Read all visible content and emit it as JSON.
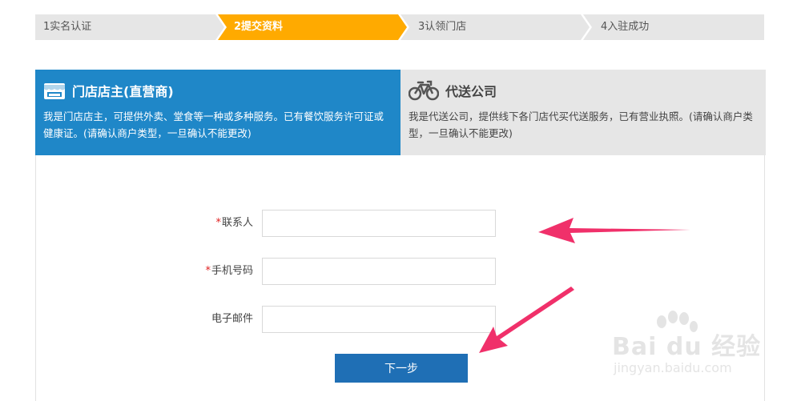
{
  "steps": [
    {
      "label": "1实名认证",
      "state": "done"
    },
    {
      "label": "2提交资料",
      "state": "active"
    },
    {
      "label": "3认领门店",
      "state": "pending"
    },
    {
      "label": "4入驻成功",
      "state": "pending"
    }
  ],
  "colors": {
    "step_active": "#ffaa00",
    "step_inactive": "#e6e6e6",
    "tab_active": "#1f87c8",
    "tab_inactive": "#e6e6e6",
    "button": "#1f6fb5",
    "required": "#e02020",
    "annotation_arrow": "#f0306a"
  },
  "merchant_types": [
    {
      "icon": "storefront-icon",
      "title": "门店店主(直营商)",
      "description": "我是门店店主，可提供外卖、堂食等一种或多种服务。已有餐饮服务许可证或健康证。(请确认商户类型，一旦确认不能更改)",
      "selected": true
    },
    {
      "icon": "bicycle-icon",
      "title": "代送公司",
      "description": "我是代送公司，提供线下各门店代买代送服务，已有营业执照。(请确认商户类型，一旦确认不能更改)",
      "selected": false
    }
  ],
  "form": {
    "fields": [
      {
        "label": "联系人",
        "required": true,
        "value": "",
        "placeholder": ""
      },
      {
        "label": "手机号码",
        "required": true,
        "value": "",
        "placeholder": ""
      },
      {
        "label": "电子邮件",
        "required": false,
        "value": "",
        "placeholder": ""
      }
    ],
    "required_mark": "*",
    "next_label": "下一步"
  },
  "watermark": {
    "main": "Bai du 经验",
    "sub": "jingyan.baidu.com"
  }
}
